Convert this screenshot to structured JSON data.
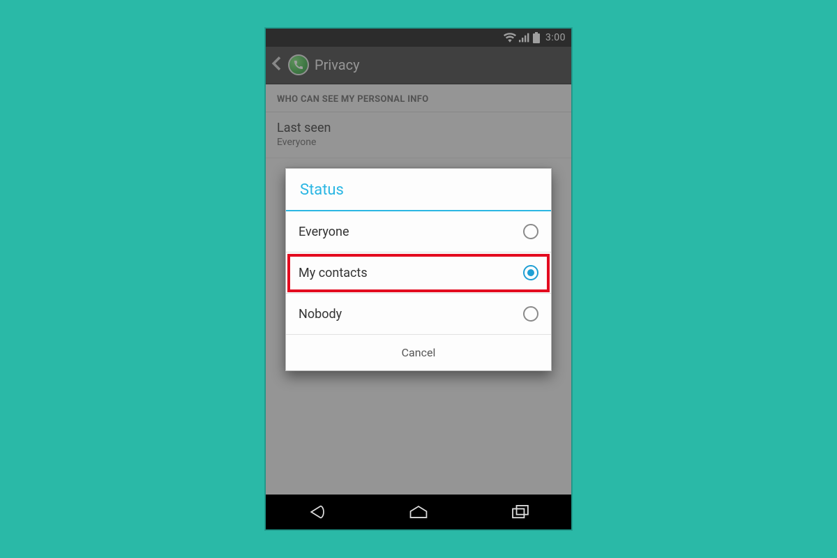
{
  "statusbar": {
    "time": "3:00"
  },
  "actionbar": {
    "title": "Privacy"
  },
  "section_header": "WHO CAN SEE MY PERSONAL INFO",
  "prefs": {
    "last_seen": {
      "title": "Last seen",
      "value": "Everyone"
    }
  },
  "dialog": {
    "title": "Status",
    "options": [
      {
        "label": "Everyone",
        "selected": false,
        "highlighted": false
      },
      {
        "label": "My contacts",
        "selected": true,
        "highlighted": true
      },
      {
        "label": "Nobody",
        "selected": false,
        "highlighted": false
      }
    ],
    "cancel_label": "Cancel"
  }
}
